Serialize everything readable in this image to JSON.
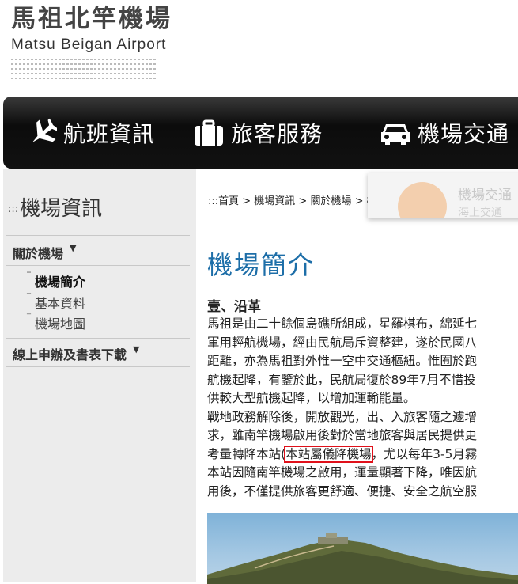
{
  "header": {
    "logo_zh": "馬祖北竿機場",
    "logo_en": "Matsu Beigan Airport"
  },
  "nav": {
    "items": [
      {
        "label": "航班資訊",
        "icon": "airplane-icon"
      },
      {
        "label": "旅客服務",
        "icon": "luggage-icon"
      },
      {
        "label": "機場交通",
        "icon": "car-icon"
      }
    ]
  },
  "sidebar": {
    "title": "機場資訊",
    "sections": [
      {
        "label": "關於機場",
        "items": [
          "機場簡介",
          "基本資料",
          "機場地圖"
        ],
        "active": "機場簡介"
      },
      {
        "label": "線上申辦及書表下載"
      }
    ]
  },
  "breadcrumb": {
    "text": ":::首頁 > 機場資訊 > 關於機場 > 機場簡介"
  },
  "popup": {
    "title": "機場交通",
    "sub": "海上交通"
  },
  "main": {
    "title": "機場簡介",
    "section_heading": "壹、沿革",
    "para1": [
      "馬祖是由二十餘個島礁所組成，星羅棋布，綿延七",
      "軍用輕航機場，經由民航局斥資整建，遂於民國八",
      "距離，亦為馬祖對外惟一空中交通樞紐。惟囿於跑",
      "航機起降，有鑒於此，民航局復於89年7月不惜投",
      "供較大型航機起降，以增加運輸能量。"
    ],
    "para2": [
      "戰地政務解除後，開放觀光，出、入旅客隨之遽增",
      "求，雖南竿機場啟用後對於當地旅客與居民提供更"
    ],
    "line_pre": "考量轉降本站(",
    "line_highlight": "本站屬儀降機場",
    "line_post": "，尤以每年3-5月霧",
    "para3": [
      "本站因隨南竿機場之啟用，運量顯著下降，唯因航",
      "用後，不僅提供旅客更舒適、便捷、安全之航空服"
    ]
  },
  "colors": {
    "title_blue": "#1d6ea8",
    "highlight_red": "#e0101a",
    "nav_black": "#111111",
    "sidebar_gray": "#ececec"
  }
}
